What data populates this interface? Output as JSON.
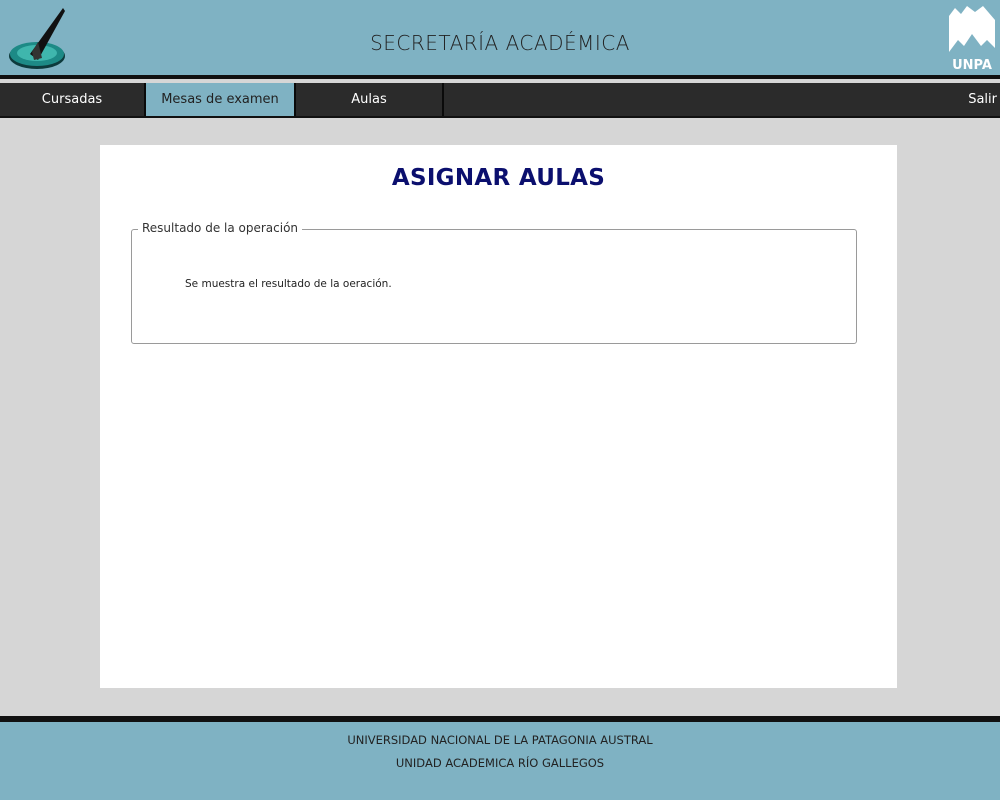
{
  "header": {
    "title": "SECRETARÍA ACADÉMICA",
    "left_logo_icon": "sundial-logo-icon",
    "right_logo_icon": "unpa-mountain-logo-icon",
    "right_logo_text": "UNPA"
  },
  "nav": {
    "tabs": [
      {
        "label": "Cursadas",
        "active": false
      },
      {
        "label": "Mesas de examen",
        "active": true
      },
      {
        "label": "Aulas",
        "active": false
      }
    ],
    "logout_label": "Salir"
  },
  "main": {
    "title": "ASIGNAR AULAS",
    "result": {
      "legend": "Resultado de la operación",
      "message": "Se muestra el resultado de la oeración."
    }
  },
  "footer": {
    "line1": "UNIVERSIDAD NACIONAL DE LA PATAGONIA AUSTRAL",
    "line2": "UNIDAD ACADEMICA RÍO GALLEGOS"
  },
  "colors": {
    "header_bg": "#7fb2c3",
    "nav_bg": "#2b2b2b",
    "page_bg": "#d6d6d6",
    "title_color": "#0b0f6e"
  }
}
